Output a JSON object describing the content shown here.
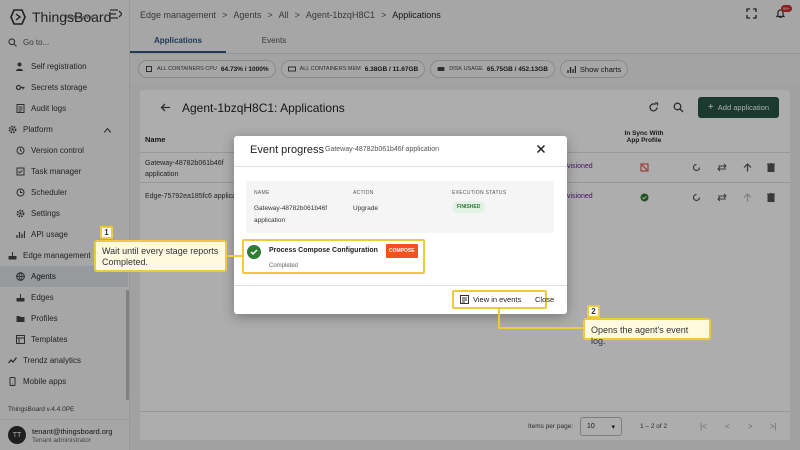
{
  "app": {
    "logo_text": "ThingsBoard",
    "logo_sub": "Professional",
    "goto_label": "Go to...",
    "version": "ThingsBoard v.4.4.0PE",
    "user_initials": "TT",
    "user_email": "tenant@thingsboard.org",
    "user_role": "Tenant administrator",
    "notification_badge": "99+"
  },
  "sidebar": {
    "items": [
      {
        "label": "Self registration",
        "icon": "person-add-icon"
      },
      {
        "label": "Secrets storage",
        "icon": "key-icon"
      },
      {
        "label": "Audit logs",
        "icon": "list-icon"
      },
      {
        "label": "Platform",
        "icon": "gear-icon"
      },
      {
        "label": "Version control",
        "icon": "history-icon"
      },
      {
        "label": "Task manager",
        "icon": "tasks-icon"
      },
      {
        "label": "Scheduler",
        "icon": "clock-icon"
      },
      {
        "label": "Settings",
        "icon": "gear-icon"
      },
      {
        "label": "API usage",
        "icon": "chart-icon"
      },
      {
        "label": "Edge management",
        "icon": "router-icon"
      },
      {
        "label": "Agents",
        "icon": "globe-icon"
      },
      {
        "label": "Edges",
        "icon": "router-icon"
      },
      {
        "label": "Profiles",
        "icon": "folder-icon"
      },
      {
        "label": "Templates",
        "icon": "template-icon"
      },
      {
        "label": "Trendz analytics",
        "icon": "analytics-icon"
      },
      {
        "label": "Mobile apps",
        "icon": "phone-icon"
      }
    ]
  },
  "breadcrumb": [
    "Edge management",
    "Agents",
    "All",
    "Agent-1bzqH8C1",
    "Applications"
  ],
  "tabs": [
    "Applications",
    "Events"
  ],
  "stats": [
    {
      "label": "ALL CONTAINERS CPU",
      "value": "64.73% / 1000%"
    },
    {
      "label": "ALL CONTAINERS MEM",
      "value": "6.38GB / 11.67GB"
    },
    {
      "label": "DISK USAGE",
      "value": "65.75GB / 452.13GB"
    }
  ],
  "show_charts": "Show charts",
  "panel": {
    "title": "Agent-1bzqH8C1: Applications",
    "add_button": "Add application",
    "col_name": "Name",
    "col_sync": "In Sync With",
    "col_sync2": "App Profile",
    "rows": [
      {
        "name1": "Gateway-48782b061b46f",
        "name2": "application",
        "status": "visioned"
      },
      {
        "name1": "Edge-75792ea185fc6 applica",
        "name2": "",
        "status": "visioned"
      }
    ],
    "items_per_page": "Items per page:",
    "page_size": "10",
    "range": "1 – 2 of 2"
  },
  "dialog": {
    "title": "Event progress",
    "subtitle": "Gateway-48782b061b46f application",
    "h_name": "NAME",
    "h_action": "ACTION",
    "h_status": "EXECUTION STATUS",
    "v_name1": "Gateway-48782b061b46f",
    "v_name2": "application",
    "v_action": "Upgrade",
    "v_status": "FINISHED",
    "step_name": "Process Compose Configuration",
    "step_tag": "COMPOSE",
    "step_state": "Completed",
    "view_events": "View in events",
    "close": "Close"
  },
  "callouts": [
    {
      "num": "1",
      "text1": "Wait until every stage reports",
      "text2": "Completed."
    },
    {
      "num": "2",
      "text1": "Opens the agent's event log."
    }
  ],
  "colors": {
    "accent": "#305680",
    "primary_button": "#275546",
    "callout": "#f0c93e",
    "success": "#2e7d32",
    "compose_tag": "#f4511e"
  }
}
